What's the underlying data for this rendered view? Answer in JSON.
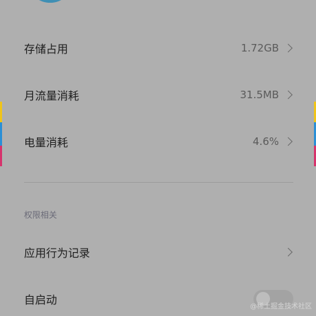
{
  "colors": {
    "background": "#afafaf",
    "app_icon": "#3f8fb4",
    "edge_yellow": "#f0c419",
    "edge_blue": "#2a8fd6",
    "edge_pink": "#d6336c"
  },
  "usage": {
    "storage": {
      "label": "存储占用",
      "value": "1.72GB"
    },
    "monthly_traffic": {
      "label": "月流量消耗",
      "value": "31.5MB"
    },
    "battery": {
      "label": "电量消耗",
      "value": "4.6%"
    }
  },
  "permissions": {
    "section_title": "权限相关",
    "behavior_log": {
      "label": "应用行为记录"
    },
    "autostart": {
      "label": "自启动",
      "enabled": false
    }
  },
  "watermark": "@稀土掘金技术社区"
}
